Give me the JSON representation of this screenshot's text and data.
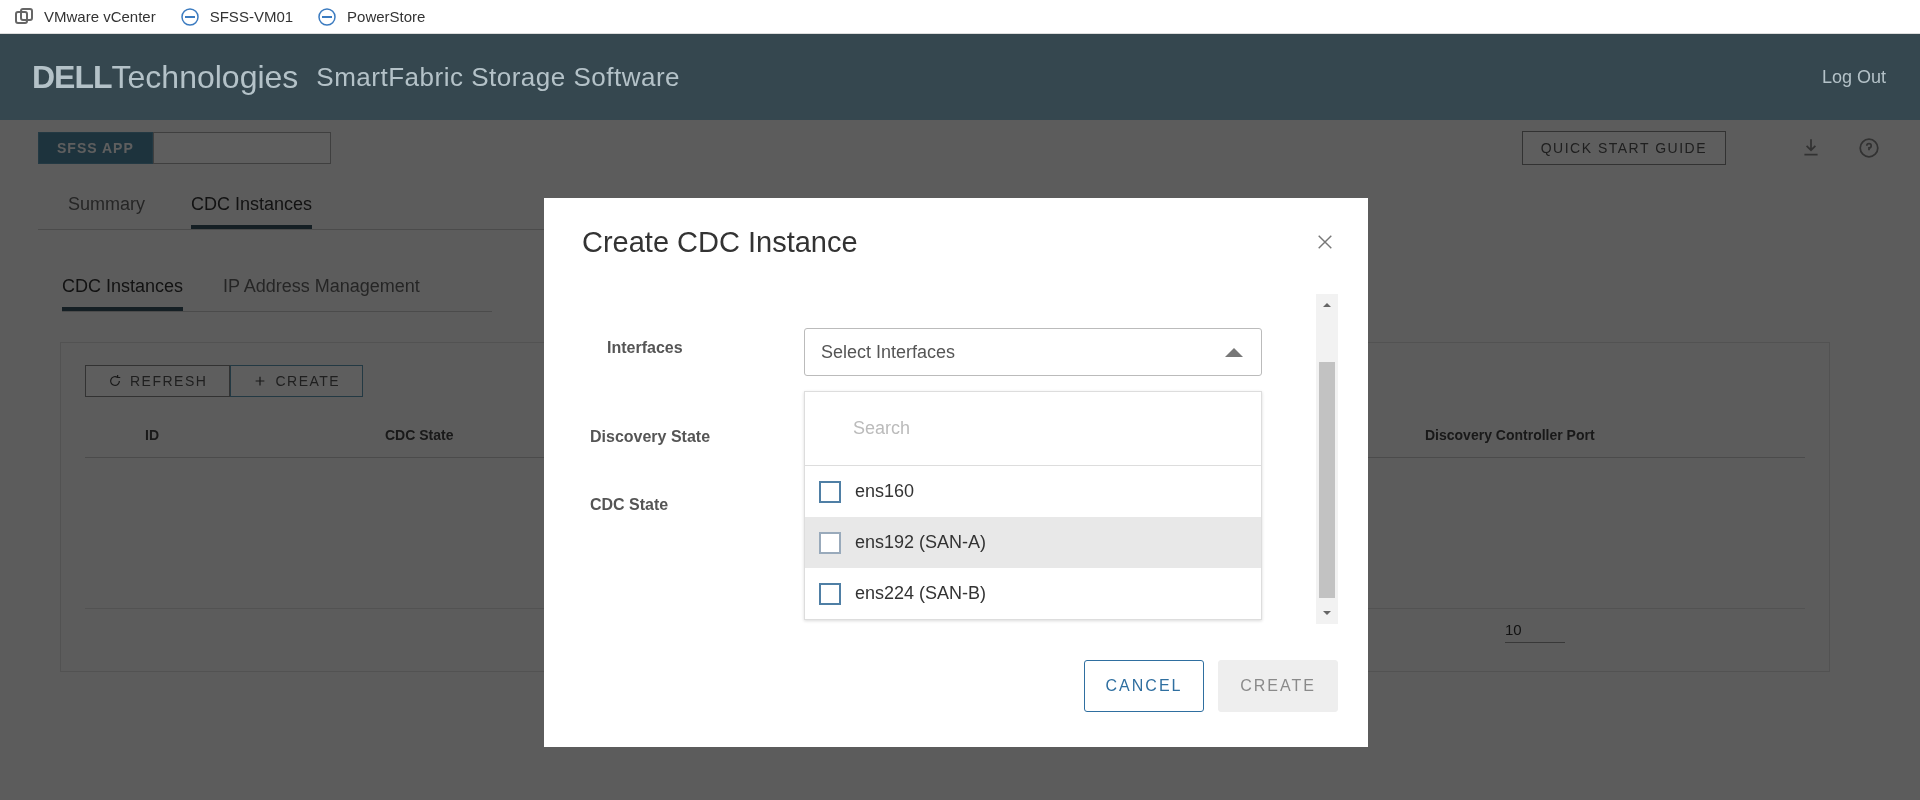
{
  "bookmarks": [
    {
      "label": "VMware vCenter",
      "kind": "vmware"
    },
    {
      "label": "SFSS-VM01",
      "kind": "dell"
    },
    {
      "label": "PowerStore",
      "kind": "dell"
    }
  ],
  "header": {
    "logo_brand": "DELL",
    "logo_suffix": "Technologies",
    "app_title": "SmartFabric Storage Software",
    "logout": "Log Out"
  },
  "app_switch": [
    {
      "label": "SFSS APP",
      "selected": true
    }
  ],
  "toolbar": {
    "quick_start": "QUICK START GUIDE"
  },
  "tabs": [
    {
      "label": "Summary",
      "selected": false
    },
    {
      "label": "CDC Instances",
      "selected": true
    }
  ],
  "subtabs": [
    {
      "label": "CDC Instances",
      "selected": true
    },
    {
      "label": "IP Address Management",
      "selected": false
    }
  ],
  "actions": [
    {
      "label": "REFRESH",
      "kind": "refresh"
    },
    {
      "label": "CREATE",
      "kind": "create"
    }
  ],
  "table": {
    "columns": [
      "ID",
      "CDC State",
      "Discovery Controller Port"
    ]
  },
  "pagination": {
    "page_size": "10"
  },
  "dialog": {
    "title": "Create CDC Instance",
    "fields": [
      {
        "label": "Interfaces"
      },
      {
        "label": "Discovery State"
      },
      {
        "label": "CDC State"
      }
    ],
    "select": {
      "placeholder": "Select Interfaces",
      "expanded": true
    },
    "search": {
      "placeholder": "Search"
    },
    "options": [
      {
        "label": "ens160",
        "checked": false,
        "hovered": false
      },
      {
        "label": "ens192 (SAN-A)",
        "checked": false,
        "hovered": true
      },
      {
        "label": "ens224 (SAN-B)",
        "checked": false,
        "hovered": false
      }
    ],
    "buttons": [
      {
        "label": "CANCEL",
        "disabled": false
      },
      {
        "label": "CREATE",
        "disabled": true
      }
    ]
  }
}
